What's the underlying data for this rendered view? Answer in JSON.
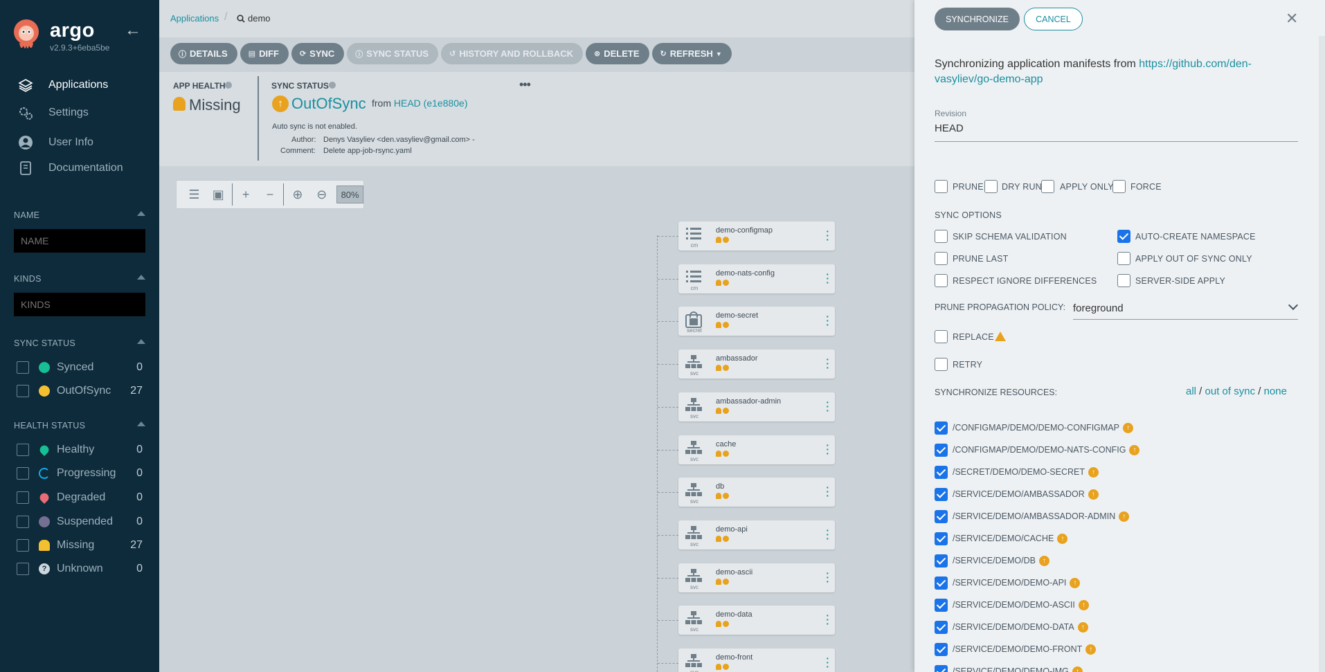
{
  "sidebar": {
    "brand": "argo",
    "version": "v2.9.3+6eba5be",
    "nav": [
      {
        "label": "Applications",
        "icon": "layers-icon"
      },
      {
        "label": "Settings",
        "icon": "gears-icon"
      },
      {
        "label": "User Info",
        "icon": "user-icon"
      },
      {
        "label": "Documentation",
        "icon": "book-icon"
      }
    ],
    "filters": {
      "name_label": "NAME",
      "name_placeholder": "NAME",
      "kinds_label": "KINDS",
      "kinds_placeholder": "KINDS",
      "sync_status_label": "SYNC STATUS",
      "sync_status": [
        {
          "label": "Synced",
          "count": "0",
          "color": "#18be94"
        },
        {
          "label": "OutOfSync",
          "count": "27",
          "color": "#f4c030"
        }
      ],
      "health_status_label": "HEALTH STATUS",
      "health_status": [
        {
          "label": "Healthy",
          "count": "0",
          "color": "#18be94"
        },
        {
          "label": "Progressing",
          "count": "0",
          "color": "#0dadea"
        },
        {
          "label": "Degraded",
          "count": "0",
          "color": "#e96d76"
        },
        {
          "label": "Suspended",
          "count": "0",
          "color": "#766f94"
        },
        {
          "label": "Missing",
          "count": "27",
          "color": "#f4c030"
        },
        {
          "label": "Unknown",
          "count": "0",
          "color": "#ccd6dd"
        }
      ]
    }
  },
  "topbar": {
    "breadcrumb": "Applications",
    "search": "demo"
  },
  "toolbar": {
    "buttons": [
      {
        "label": "DETAILS",
        "icon": "info-icon"
      },
      {
        "label": "DIFF",
        "icon": "file-icon"
      },
      {
        "label": "SYNC",
        "icon": "sync-icon"
      },
      {
        "label": "SYNC STATUS",
        "icon": "info-icon"
      },
      {
        "label": "HISTORY AND ROLLBACK",
        "icon": "history-icon"
      },
      {
        "label": "DELETE",
        "icon": "times-circle-icon"
      },
      {
        "label": "REFRESH",
        "icon": "refresh-icon"
      }
    ]
  },
  "status": {
    "app_health_label": "APP HEALTH",
    "app_health_value": "Missing",
    "sync_status_label": "SYNC STATUS",
    "sync_status_value": "OutOfSync",
    "from_prefix": "from",
    "revision_link": "HEAD (e1e880e)",
    "auto_sync": "Auto sync is not enabled.",
    "author_label": "Author:",
    "author_value": "Denys Vasyliev <den.vasyliev@gmail.com> -",
    "comment_label": "Comment:",
    "comment_value": "Delete app-job-rsync.yaml"
  },
  "zoom": {
    "value": "80%"
  },
  "nodes": [
    {
      "name": "demo-configmap",
      "kind": "cm"
    },
    {
      "name": "demo-nats-config",
      "kind": "cm"
    },
    {
      "name": "demo-secret",
      "kind": "secret"
    },
    {
      "name": "ambassador",
      "kind": "svc"
    },
    {
      "name": "ambassador-admin",
      "kind": "svc"
    },
    {
      "name": "cache",
      "kind": "svc"
    },
    {
      "name": "db",
      "kind": "svc"
    },
    {
      "name": "demo-api",
      "kind": "svc"
    },
    {
      "name": "demo-ascii",
      "kind": "svc"
    },
    {
      "name": "demo-data",
      "kind": "svc"
    },
    {
      "name": "demo-front",
      "kind": "svc"
    }
  ],
  "panel": {
    "synchronize_button": "SYNCHRONIZE",
    "cancel_button": "CANCEL",
    "message_prefix": "Synchronizing application manifests from ",
    "repo_url_line1": "https://github.com/den-",
    "repo_url_line2": "vasyliev/go-demo-app",
    "revision_label": "Revision",
    "revision_value": "HEAD",
    "options": [
      {
        "label": "PRUNE",
        "checked": false
      },
      {
        "label": "DRY RUN",
        "checked": false
      },
      {
        "label": "APPLY ONLY",
        "checked": false
      },
      {
        "label": "FORCE",
        "checked": false
      }
    ],
    "sync_options_label": "SYNC OPTIONS",
    "sync_options": [
      {
        "label": "SKIP SCHEMA VALIDATION",
        "checked": false
      },
      {
        "label": "AUTO-CREATE NAMESPACE",
        "checked": true
      },
      {
        "label": "PRUNE LAST",
        "checked": false
      },
      {
        "label": "APPLY OUT OF SYNC ONLY",
        "checked": false
      },
      {
        "label": "RESPECT IGNORE DIFFERENCES",
        "checked": false
      },
      {
        "label": "SERVER-SIDE APPLY",
        "checked": false
      }
    ],
    "prune_policy_label": "PRUNE PROPAGATION POLICY:",
    "prune_policy_value": "foreground",
    "replace_label": "REPLACE",
    "retry_label": "RETRY",
    "sync_resources_label": "SYNCHRONIZE RESOURCES:",
    "link_all": "all",
    "link_out_of_sync": "out of sync",
    "link_none": "none",
    "resources": [
      "/CONFIGMAP/DEMO/DEMO-CONFIGMAP",
      "/CONFIGMAP/DEMO/DEMO-NATS-CONFIG",
      "/SECRET/DEMO/DEMO-SECRET",
      "/SERVICE/DEMO/AMBASSADOR",
      "/SERVICE/DEMO/AMBASSADOR-ADMIN",
      "/SERVICE/DEMO/CACHE",
      "/SERVICE/DEMO/DB",
      "/SERVICE/DEMO/DEMO-API",
      "/SERVICE/DEMO/DEMO-ASCII",
      "/SERVICE/DEMO/DEMO-DATA",
      "/SERVICE/DEMO/DEMO-FRONT",
      "/SERVICE/DEMO/DEMO-IMG"
    ]
  }
}
